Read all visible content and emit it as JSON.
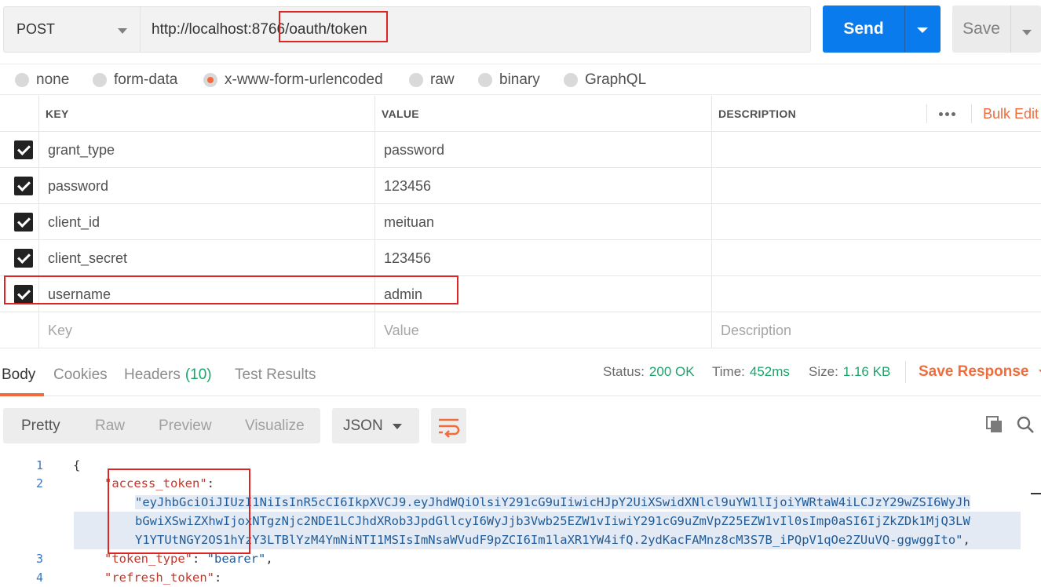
{
  "request": {
    "method": "POST",
    "url": "http://localhost:8766/oauth/token",
    "send_label": "Send",
    "save_label": "Save"
  },
  "body_types": [
    {
      "label": "none",
      "selected": false
    },
    {
      "label": "form-data",
      "selected": false
    },
    {
      "label": "x-www-form-urlencoded",
      "selected": true
    },
    {
      "label": "raw",
      "selected": false
    },
    {
      "label": "binary",
      "selected": false
    },
    {
      "label": "GraphQL",
      "selected": false
    }
  ],
  "params_table": {
    "headers": {
      "key": "KEY",
      "value": "VALUE",
      "description": "DESCRIPTION"
    },
    "bulk_edit_label": "Bulk Edit",
    "rows": [
      {
        "checked": true,
        "key": "grant_type",
        "value": "password"
      },
      {
        "checked": true,
        "key": "password",
        "value": "123456"
      },
      {
        "checked": true,
        "key": "client_id",
        "value": "meituan"
      },
      {
        "checked": true,
        "key": "client_secret",
        "value": "123456"
      },
      {
        "checked": true,
        "key": "username",
        "value": "admin"
      }
    ],
    "placeholders": {
      "key": "Key",
      "value": "Value",
      "description": "Description"
    }
  },
  "response": {
    "tabs": {
      "body": "Body",
      "cookies": "Cookies",
      "headers": "Headers",
      "headers_count": "(10)",
      "test_results": "Test Results"
    },
    "status_label": "Status:",
    "status_value": "200 OK",
    "time_label": "Time:",
    "time_value": "452ms",
    "size_label": "Size:",
    "size_value": "1.16 KB",
    "save_response_label": "Save Response",
    "view_modes": [
      "Pretty",
      "Raw",
      "Preview",
      "Visualize"
    ],
    "active_view": "Pretty",
    "format": "JSON"
  },
  "code": {
    "line_numbers": [
      "1",
      "2",
      "3",
      "4"
    ],
    "open_brace": "{",
    "access_token_key": "\"access_token\"",
    "token_line_1": "\"eyJhbGciOiJIUzI1NiIsInR5cCI6IkpXVCJ9.eyJhdWQiOlsiY291cG9uIiwicHJpY2UiXSwidXNlcl9uYW1lIjoiYWRtaW4iLCJzY29wZSI6WyJh",
    "token_line_2": "bGwiXSwiZXhwIjoxNTgzNjc2NDE1LCJhdXRob3JpdGllcyI6WyJjb3Vwb25EZW1vIiwiY291cG9uZmVpZ25EZW1vIl0sImp0aSI6IjZkZDk1MjQ3LW",
    "token_line_3": "Y1YTUtNGY2OS1hYzY3LTBlYzM4YmNiNTI1MSIsImNsaWVudF9pZCI6Im1laXR1YW4ifQ.2ydKacFAMnz8cM3S7B_iPQpV1qOe2ZUuVQ-ggwggIto\"",
    "token_type_key": "\"token_type\"",
    "token_type_value": "\"bearer\"",
    "refresh_token_key": "\"refresh_token\""
  },
  "colors": {
    "accent": "#f26b3a",
    "send_button": "#097bed",
    "status_ok": "#1aa56b",
    "annotation_red": "#e02424"
  }
}
